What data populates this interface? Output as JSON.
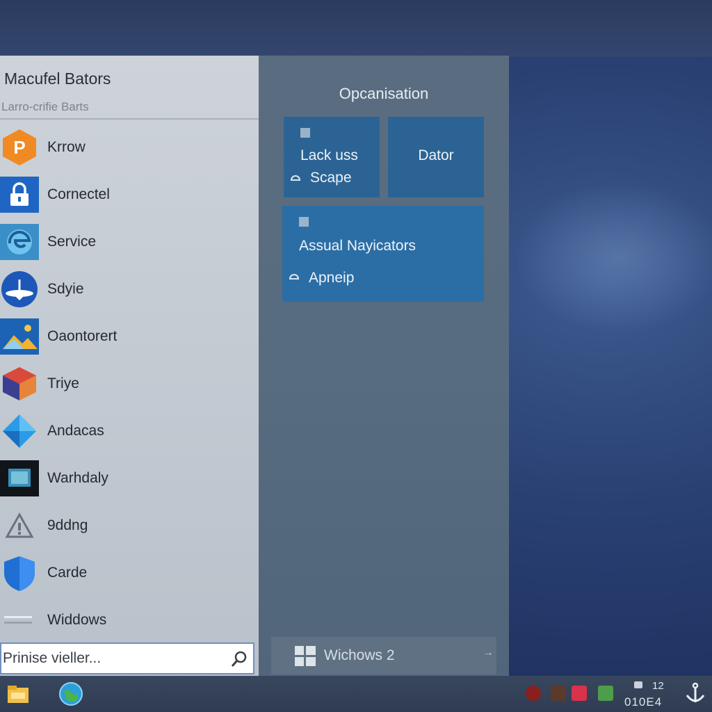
{
  "start_menu": {
    "user": {
      "name": "Macufel Bators",
      "subtitle": "Larro-crifie Barts"
    },
    "apps": [
      {
        "label": "Krrow",
        "icon": "p-orange-hexagon-icon"
      },
      {
        "label": "Cornectel",
        "icon": "lock-icon"
      },
      {
        "label": "Service",
        "icon": "edge-browser-icon"
      },
      {
        "label": "Sdyie",
        "icon": "globe-pin-icon"
      },
      {
        "label": "Oaontorert",
        "icon": "landscape-image-icon"
      },
      {
        "label": "Triye",
        "icon": "cube-stack-icon"
      },
      {
        "label": "Andacas",
        "icon": "blue-diamond-icon"
      },
      {
        "label": "Warhdaly",
        "icon": "dark-monitor-icon"
      },
      {
        "label": "9ddng",
        "icon": "warning-triangle-icon"
      },
      {
        "label": "Carde",
        "icon": "shield-icon"
      },
      {
        "label": "Widdows",
        "icon": "lines-icon"
      }
    ],
    "search": {
      "placeholder": "Prinise vieller..."
    },
    "tiles": {
      "group_title": "Opcanisation",
      "tile1": {
        "line1": "Lack uss",
        "line2": "Scape"
      },
      "tile2": {
        "label": "Dator"
      },
      "tile3": {
        "line1": "Assual Nayicators",
        "line2": "Apneip"
      }
    },
    "power": {
      "label": "Wichows 2"
    }
  },
  "taskbar": {
    "clock_time": "12",
    "clock_date": "010E4"
  },
  "colors": {
    "tile_dark": "#2b6494",
    "tile_wide": "#2b6ea6",
    "accent_search_border": "#6f8fbf"
  }
}
